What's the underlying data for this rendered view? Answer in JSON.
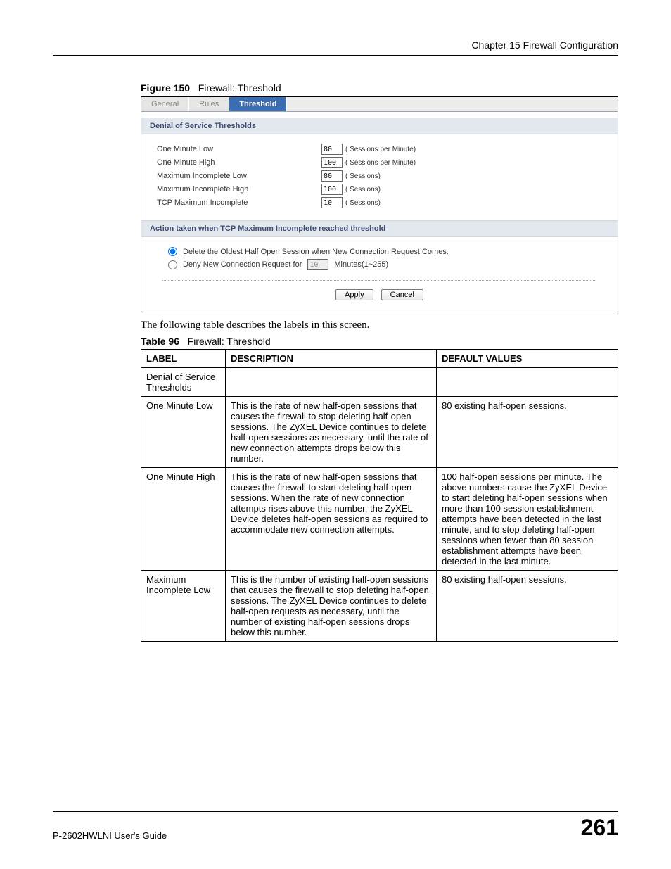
{
  "chapter_header": "Chapter 15 Firewall Configuration",
  "figure": {
    "number": "Figure 150",
    "title": "Firewall: Threshold"
  },
  "ui": {
    "tabs": {
      "general": "General",
      "rules": "Rules",
      "threshold": "Threshold"
    },
    "section1": "Denial of Service Thresholds",
    "rows": {
      "one_min_low": {
        "label": "One Minute Low",
        "value": "80",
        "unit": "( Sessions per Minute)"
      },
      "one_min_high": {
        "label": "One Minute High",
        "value": "100",
        "unit": "( Sessions per Minute)"
      },
      "max_inc_low": {
        "label": "Maximum Incomplete Low",
        "value": "80",
        "unit": "( Sessions)"
      },
      "max_inc_high": {
        "label": "Maximum Incomplete High",
        "value": "100",
        "unit": "( Sessions)"
      },
      "tcp_max_inc": {
        "label": "TCP Maximum Incomplete",
        "value": "10",
        "unit": "( Sessions)"
      }
    },
    "section2": "Action taken when TCP Maximum Incomplete reached threshold",
    "radio1": "Delete the Oldest Half Open Session when New Connection Request Comes.",
    "radio2_pre": "Deny New Connection Request for",
    "radio2_val": "10",
    "radio2_post": "Minutes(1~255)",
    "apply": "Apply",
    "cancel": "Cancel"
  },
  "intro": "The following table describes the labels in this screen.",
  "table_caption": {
    "number": "Table 96",
    "title": "Firewall: Threshold"
  },
  "table": {
    "headers": {
      "label": "LABEL",
      "desc": "DESCRIPTION",
      "def": "DEFAULT VALUES"
    },
    "rows": [
      {
        "label": "Denial of Service Thresholds",
        "desc": "",
        "def": ""
      },
      {
        "label": "One Minute Low",
        "desc": "This is the rate of new half-open sessions that causes the firewall to stop deleting half-open sessions. The ZyXEL Device continues to delete half-open sessions as necessary, until the rate of new connection attempts drops below this number.",
        "def": "80 existing half-open sessions."
      },
      {
        "label": "One Minute High",
        "desc": "This is the rate of new half-open sessions that causes the firewall to start deleting half-open sessions. When the rate of new connection attempts rises above this number, the ZyXEL Device deletes half-open sessions as required to accommodate new connection attempts.",
        "def": "100 half-open sessions per minute. The above numbers cause the ZyXEL Device to start deleting half-open sessions when more than 100 session establishment attempts have been detected in the last minute, and to stop deleting half-open sessions when fewer than 80 session establishment attempts have been detected in the last minute."
      },
      {
        "label": "Maximum Incomplete Low",
        "desc": "This is the number of existing half-open sessions that causes the firewall to stop deleting half-open sessions. The ZyXEL Device continues to delete half-open requests as necessary, until the number of existing half-open sessions drops below this number.",
        "def": "80 existing half-open sessions."
      }
    ]
  },
  "footer": {
    "guide": "P-2602HWLNI User's Guide",
    "page": "261"
  }
}
